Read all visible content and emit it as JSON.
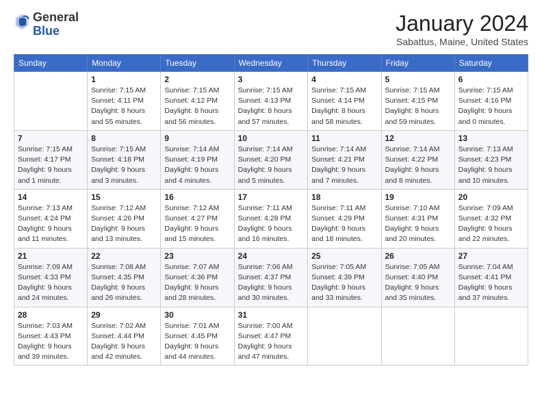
{
  "header": {
    "logo_general": "General",
    "logo_blue": "Blue",
    "month_year": "January 2024",
    "location": "Sabattus, Maine, United States"
  },
  "weekdays": [
    "Sunday",
    "Monday",
    "Tuesday",
    "Wednesday",
    "Thursday",
    "Friday",
    "Saturday"
  ],
  "weeks": [
    [
      {
        "day": "",
        "sunrise": "",
        "sunset": "",
        "daylight": ""
      },
      {
        "day": "1",
        "sunrise": "Sunrise: 7:15 AM",
        "sunset": "Sunset: 4:11 PM",
        "daylight": "Daylight: 8 hours and 55 minutes."
      },
      {
        "day": "2",
        "sunrise": "Sunrise: 7:15 AM",
        "sunset": "Sunset: 4:12 PM",
        "daylight": "Daylight: 8 hours and 56 minutes."
      },
      {
        "day": "3",
        "sunrise": "Sunrise: 7:15 AM",
        "sunset": "Sunset: 4:13 PM",
        "daylight": "Daylight: 8 hours and 57 minutes."
      },
      {
        "day": "4",
        "sunrise": "Sunrise: 7:15 AM",
        "sunset": "Sunset: 4:14 PM",
        "daylight": "Daylight: 8 hours and 58 minutes."
      },
      {
        "day": "5",
        "sunrise": "Sunrise: 7:15 AM",
        "sunset": "Sunset: 4:15 PM",
        "daylight": "Daylight: 8 hours and 59 minutes."
      },
      {
        "day": "6",
        "sunrise": "Sunrise: 7:15 AM",
        "sunset": "Sunset: 4:16 PM",
        "daylight": "Daylight: 9 hours and 0 minutes."
      }
    ],
    [
      {
        "day": "7",
        "sunrise": "Sunrise: 7:15 AM",
        "sunset": "Sunset: 4:17 PM",
        "daylight": "Daylight: 9 hours and 1 minute."
      },
      {
        "day": "8",
        "sunrise": "Sunrise: 7:15 AM",
        "sunset": "Sunset: 4:18 PM",
        "daylight": "Daylight: 9 hours and 3 minutes."
      },
      {
        "day": "9",
        "sunrise": "Sunrise: 7:14 AM",
        "sunset": "Sunset: 4:19 PM",
        "daylight": "Daylight: 9 hours and 4 minutes."
      },
      {
        "day": "10",
        "sunrise": "Sunrise: 7:14 AM",
        "sunset": "Sunset: 4:20 PM",
        "daylight": "Daylight: 9 hours and 5 minutes."
      },
      {
        "day": "11",
        "sunrise": "Sunrise: 7:14 AM",
        "sunset": "Sunset: 4:21 PM",
        "daylight": "Daylight: 9 hours and 7 minutes."
      },
      {
        "day": "12",
        "sunrise": "Sunrise: 7:14 AM",
        "sunset": "Sunset: 4:22 PM",
        "daylight": "Daylight: 9 hours and 8 minutes."
      },
      {
        "day": "13",
        "sunrise": "Sunrise: 7:13 AM",
        "sunset": "Sunset: 4:23 PM",
        "daylight": "Daylight: 9 hours and 10 minutes."
      }
    ],
    [
      {
        "day": "14",
        "sunrise": "Sunrise: 7:13 AM",
        "sunset": "Sunset: 4:24 PM",
        "daylight": "Daylight: 9 hours and 11 minutes."
      },
      {
        "day": "15",
        "sunrise": "Sunrise: 7:12 AM",
        "sunset": "Sunset: 4:26 PM",
        "daylight": "Daylight: 9 hours and 13 minutes."
      },
      {
        "day": "16",
        "sunrise": "Sunrise: 7:12 AM",
        "sunset": "Sunset: 4:27 PM",
        "daylight": "Daylight: 9 hours and 15 minutes."
      },
      {
        "day": "17",
        "sunrise": "Sunrise: 7:11 AM",
        "sunset": "Sunset: 4:28 PM",
        "daylight": "Daylight: 9 hours and 16 minutes."
      },
      {
        "day": "18",
        "sunrise": "Sunrise: 7:11 AM",
        "sunset": "Sunset: 4:29 PM",
        "daylight": "Daylight: 9 hours and 18 minutes."
      },
      {
        "day": "19",
        "sunrise": "Sunrise: 7:10 AM",
        "sunset": "Sunset: 4:31 PM",
        "daylight": "Daylight: 9 hours and 20 minutes."
      },
      {
        "day": "20",
        "sunrise": "Sunrise: 7:09 AM",
        "sunset": "Sunset: 4:32 PM",
        "daylight": "Daylight: 9 hours and 22 minutes."
      }
    ],
    [
      {
        "day": "21",
        "sunrise": "Sunrise: 7:09 AM",
        "sunset": "Sunset: 4:33 PM",
        "daylight": "Daylight: 9 hours and 24 minutes."
      },
      {
        "day": "22",
        "sunrise": "Sunrise: 7:08 AM",
        "sunset": "Sunset: 4:35 PM",
        "daylight": "Daylight: 9 hours and 26 minutes."
      },
      {
        "day": "23",
        "sunrise": "Sunrise: 7:07 AM",
        "sunset": "Sunset: 4:36 PM",
        "daylight": "Daylight: 9 hours and 28 minutes."
      },
      {
        "day": "24",
        "sunrise": "Sunrise: 7:06 AM",
        "sunset": "Sunset: 4:37 PM",
        "daylight": "Daylight: 9 hours and 30 minutes."
      },
      {
        "day": "25",
        "sunrise": "Sunrise: 7:05 AM",
        "sunset": "Sunset: 4:39 PM",
        "daylight": "Daylight: 9 hours and 33 minutes."
      },
      {
        "day": "26",
        "sunrise": "Sunrise: 7:05 AM",
        "sunset": "Sunset: 4:40 PM",
        "daylight": "Daylight: 9 hours and 35 minutes."
      },
      {
        "day": "27",
        "sunrise": "Sunrise: 7:04 AM",
        "sunset": "Sunset: 4:41 PM",
        "daylight": "Daylight: 9 hours and 37 minutes."
      }
    ],
    [
      {
        "day": "28",
        "sunrise": "Sunrise: 7:03 AM",
        "sunset": "Sunset: 4:43 PM",
        "daylight": "Daylight: 9 hours and 39 minutes."
      },
      {
        "day": "29",
        "sunrise": "Sunrise: 7:02 AM",
        "sunset": "Sunset: 4:44 PM",
        "daylight": "Daylight: 9 hours and 42 minutes."
      },
      {
        "day": "30",
        "sunrise": "Sunrise: 7:01 AM",
        "sunset": "Sunset: 4:45 PM",
        "daylight": "Daylight: 9 hours and 44 minutes."
      },
      {
        "day": "31",
        "sunrise": "Sunrise: 7:00 AM",
        "sunset": "Sunset: 4:47 PM",
        "daylight": "Daylight: 9 hours and 47 minutes."
      },
      {
        "day": "",
        "sunrise": "",
        "sunset": "",
        "daylight": ""
      },
      {
        "day": "",
        "sunrise": "",
        "sunset": "",
        "daylight": ""
      },
      {
        "day": "",
        "sunrise": "",
        "sunset": "",
        "daylight": ""
      }
    ]
  ]
}
